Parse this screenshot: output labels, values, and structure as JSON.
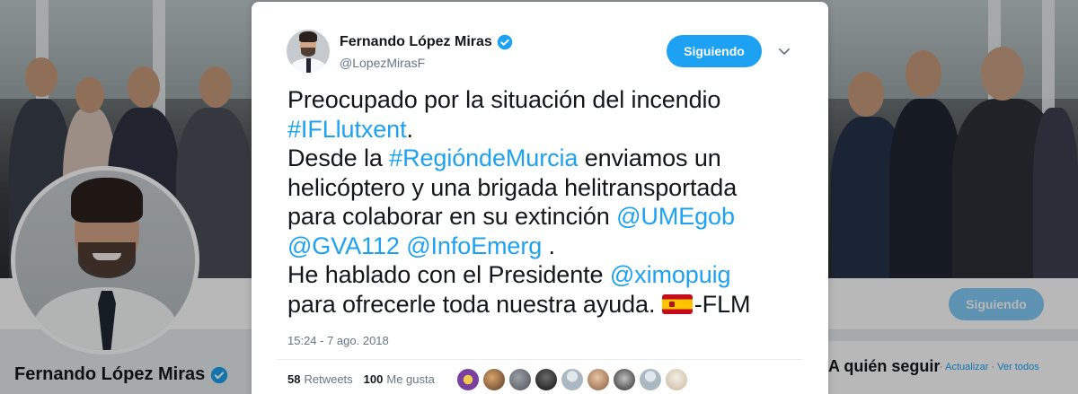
{
  "profile": {
    "name": "Fernando López Miras",
    "follow_label": "Siguiendo"
  },
  "sidebar": {
    "who_to_follow": "A quién seguir",
    "sep": "·",
    "refresh": "Actualizar",
    "view_all": "Ver todos"
  },
  "tweet": {
    "author_name": "Fernando López Miras",
    "author_handle": "@LopezMirasF",
    "follow_label": "Siguiendo",
    "text_l1": "Preocupado por la situación del incendio",
    "hashtag1": "#IFLlutxent",
    "period": ".",
    "text_l3_pre": "Desde la ",
    "hashtag2": "#RegióndeMurcia",
    "text_l3_post": " enviamos un",
    "text_l4": "helicóptero y una brigada helitransportada",
    "text_l5_pre": "para colaborar en su extinción ",
    "mention1": "@UMEgob",
    "mention2": "@GVA112",
    "space": " ",
    "mention3": "@InfoEmerg",
    "text_l6_post": " .",
    "text_l7_pre": "He hablado con el Presidente ",
    "mention4": "@ximopuig",
    "text_l8_pre": "para ofrecerle toda nuestra ayuda. ",
    "text_l8_post": "-FLM",
    "timestamp": "15:24 - 7 ago. 2018",
    "retweets_count": "58",
    "retweets_label": "Retweets",
    "likes_count": "100",
    "likes_label": "Me gusta"
  },
  "icons": {
    "verified": "verified-badge-icon",
    "caret": "chevron-down-icon",
    "flag": "spain-flag-emoji"
  },
  "colors": {
    "accent": "#1da1f2",
    "text": "#14171a",
    "muted": "#657786"
  }
}
